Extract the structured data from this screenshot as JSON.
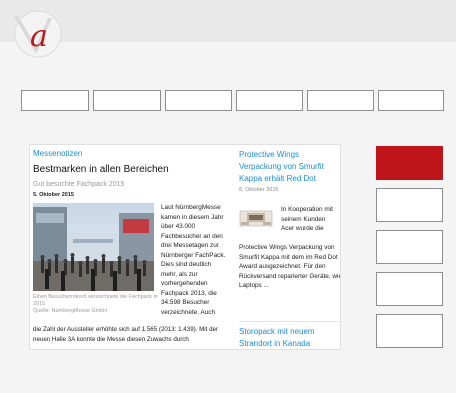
{
  "logo": {
    "letter": "a",
    "color": "#c0141b"
  },
  "nav": {
    "items": [
      "",
      "",
      "",
      "",
      "",
      ""
    ]
  },
  "news": {
    "section_label": "Messenotizen",
    "headline": "Bestmarken in allen Bereichen",
    "subheadline": "Gut besuchte Fachpack 2015",
    "date": "5. Oktober 2015",
    "photo_caption": "Einen Besucherrekord verzeichnete die Fachpack in 2015.",
    "photo_credit": "Quelle: NürnbergMesse GmbH",
    "side_text": "Laut NürnbergMesse kamen in diesem Jahr über 43.000 Fachbesucher an den drei Messetagen zur Nürnberger FachPack. Dies sind deutlich mehr, als zur vorhergehenden Fachpack 2013, die 34.598 Besucher verzeichnete. Auch",
    "bottom_text": "die Zahl der Aussteller erhöhte sich auf 1.565 (2013: 1.439). Mit der neuen Halle 3A konnte die Messe diesen Zuwachs durch"
  },
  "right_news": {
    "title": "Protective Wings Verpackung von Smurfit Kappa erhält Red Dot",
    "date": "8. Oktober 2015",
    "wrap_text": "In Kooperation mit seinem Kunden Acer wurde die",
    "text": "Protective Wings Verpackung von Smurfit Kappa mit dem im Red Dot Award ausgezeichnet. Für den Rückversand reparierter Geräte, wie Laptops ...",
    "title2": "Storopack mit neuem Strandort in Kanada"
  },
  "sidebar": {
    "buttons": [
      {
        "active": true,
        "color": "#c0141b"
      },
      {
        "active": false
      },
      {
        "active": false
      },
      {
        "active": false
      },
      {
        "active": false
      }
    ]
  },
  "colors": {
    "accent": "#c0141b",
    "link": "#1d8dd0"
  }
}
